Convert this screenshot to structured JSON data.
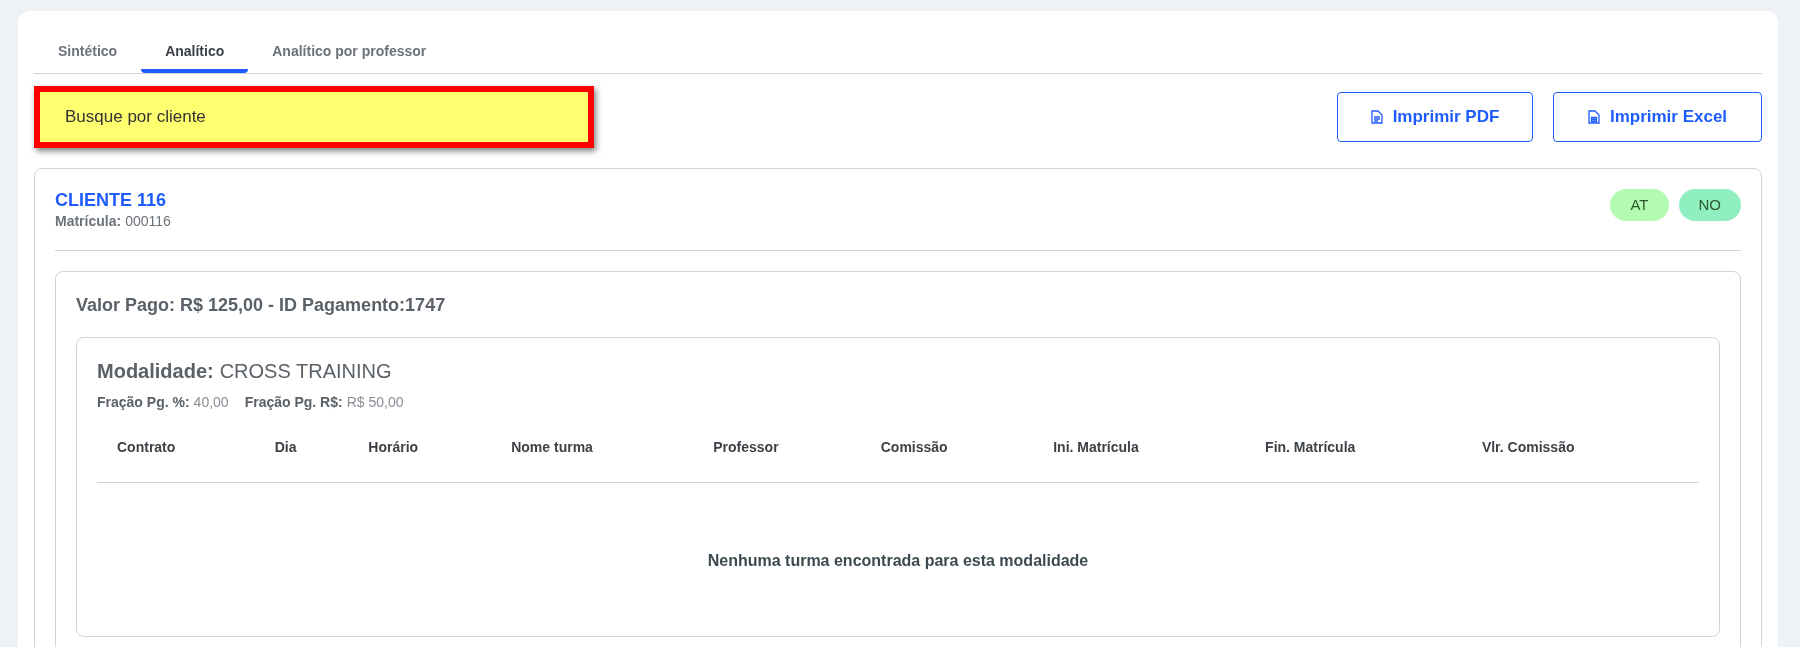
{
  "tabs": [
    {
      "label": "Sintético",
      "selected": false
    },
    {
      "label": "Analítico",
      "selected": true
    },
    {
      "label": "Analítico por professor",
      "selected": false
    }
  ],
  "search": {
    "placeholder": "Busque por cliente",
    "highlighted": true
  },
  "buttons": [
    {
      "label": "Imprimir PDF",
      "kind": "pdf"
    },
    {
      "label": "Imprimir Excel",
      "kind": "excel"
    }
  ],
  "client": {
    "name": "CLIENTE 116",
    "registration_label": "Matrícula:",
    "registration": "000116",
    "badges": [
      {
        "label": "AT",
        "color": "#b3fbb3"
      },
      {
        "label": "NO",
        "color": "#8fefc1"
      }
    ],
    "payment": {
      "title": "Valor Pago: R$ 125,00 - ID Pagamento:1747",
      "modality": {
        "label": "Modalidade:",
        "name": "CROSS TRAINING",
        "fraction_pct_label": "Fração Pg. %:",
        "fraction_pct": "40,00",
        "fraction_value_label": "Fração Pg. R$:",
        "fraction_value": "R$ 50,00",
        "table": {
          "columns": [
            "Contrato",
            "Dia",
            "Horário",
            "Nome turma",
            "Professor",
            "Comissão",
            "Ini. Matrícula",
            "Fin. Matrícula",
            "Vlr. Comissão"
          ],
          "empty_message": "Nenhuma turma encontrada para esta modalidade"
        }
      }
    }
  }
}
